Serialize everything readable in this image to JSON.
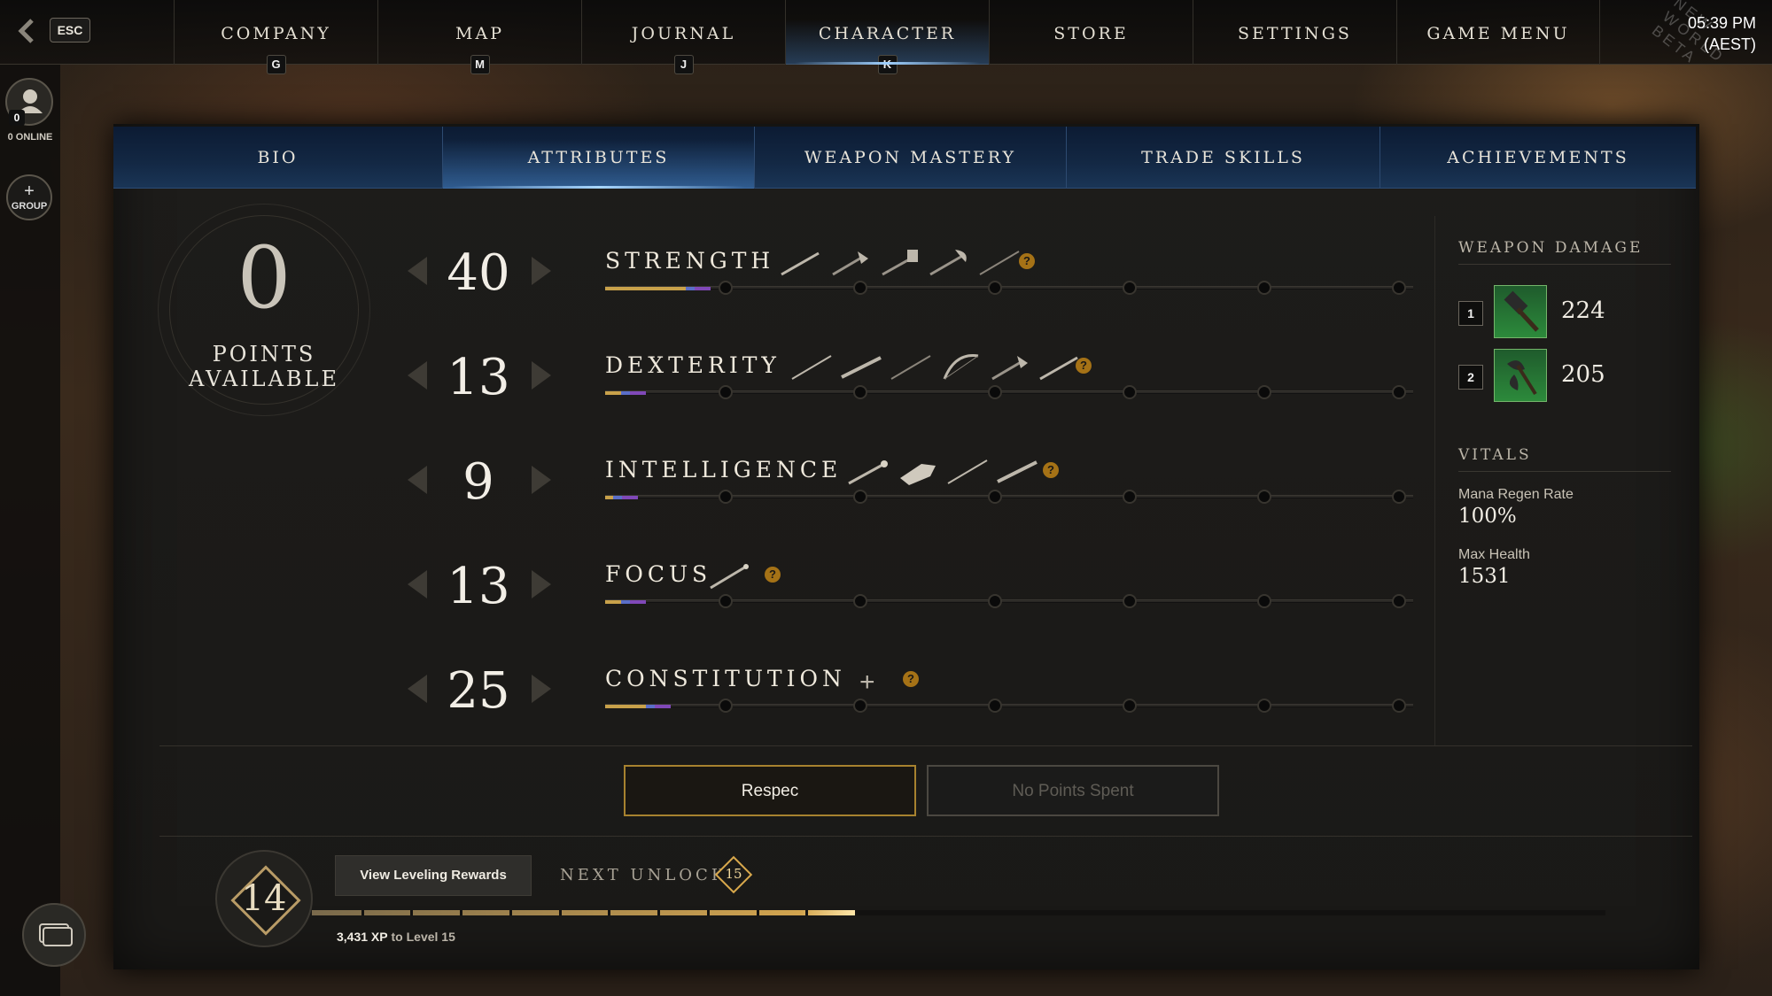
{
  "topnav": {
    "esc_label": "ESC",
    "tabs": [
      {
        "label": "COMPANY",
        "key": "G"
      },
      {
        "label": "MAP",
        "key": "M"
      },
      {
        "label": "JOURNAL",
        "key": "J"
      },
      {
        "label": "CHARACTER",
        "key": "K"
      },
      {
        "label": "STORE",
        "key": ""
      },
      {
        "label": "SETTINGS",
        "key": ""
      },
      {
        "label": "GAME MENU",
        "key": ""
      }
    ],
    "active_tab": "CHARACTER",
    "clock_time": "05:39 PM",
    "clock_zone": "(AEST)",
    "watermark_line1": "NEW WORLD",
    "watermark_line2": "BETA"
  },
  "leftrail": {
    "friends_count": "0",
    "online_label": "0 ONLINE",
    "group_plus": "+",
    "group_label": "GROUP"
  },
  "subtabs": {
    "items": [
      "BIO",
      "ATTRIBUTES",
      "WEAPON MASTERY",
      "TRADE SKILLS",
      "ACHIEVEMENTS"
    ],
    "active": "ATTRIBUTES"
  },
  "points": {
    "value": "0",
    "label_line1": "POINTS",
    "label_line2": "AVAILABLE"
  },
  "attributes": [
    {
      "name": "STRENGTH",
      "value": "40",
      "help": "?",
      "progress_fraction": 0.1,
      "weapon_icons": [
        "sword-icon",
        "hatchet-icon",
        "warhammer-icon",
        "great-axe-icon",
        "spear-icon"
      ]
    },
    {
      "name": "DEXTERITY",
      "value": "13",
      "help": "?",
      "progress_fraction": 0.02,
      "weapon_icons": [
        "rapier-icon",
        "musket-icon",
        "spear-icon",
        "bow-icon",
        "hatchet-icon",
        "sword-icon"
      ]
    },
    {
      "name": "INTELLIGENCE",
      "value": "9",
      "help": "?",
      "progress_fraction": 0.01,
      "weapon_icons": [
        "fire-staff-icon",
        "gauntlet-icon",
        "rapier-icon",
        "musket-icon"
      ]
    },
    {
      "name": "FOCUS",
      "value": "13",
      "help": "?",
      "progress_fraction": 0.02,
      "weapon_icons": [
        "life-staff-icon"
      ]
    },
    {
      "name": "CONSTITUTION",
      "value": "25",
      "help": "?",
      "progress_fraction": 0.05,
      "bonus": "+",
      "weapon_icons": []
    }
  ],
  "weapon_damage": {
    "heading": "WEAPON DAMAGE",
    "slots": [
      {
        "slot": "1",
        "icon": "warhammer-icon",
        "value": "224"
      },
      {
        "slot": "2",
        "icon": "great-axe-icon",
        "value": "205"
      }
    ]
  },
  "vitals": {
    "heading": "VITALS",
    "mana_regen_label": "Mana Regen Rate",
    "mana_regen_value": "100%",
    "max_health_label": "Max Health",
    "max_health_value": "1531"
  },
  "actions": {
    "respec_label": "Respec",
    "no_points_label": "No Points Spent"
  },
  "leveling": {
    "level": "14",
    "view_rewards_label": "View Leveling Rewards",
    "next_unlock_label": "NEXT UNLOCK",
    "next_unlock_level": "15",
    "xp_amount": "3,431 XP",
    "xp_suffix": "to Level 15",
    "xp_progress_fraction": 0.42
  },
  "colors": {
    "accent_gold": "#c8a14a",
    "tab_blue": "#132844",
    "help_orange": "#a57216",
    "weapon_green": "#2c8a3b"
  }
}
